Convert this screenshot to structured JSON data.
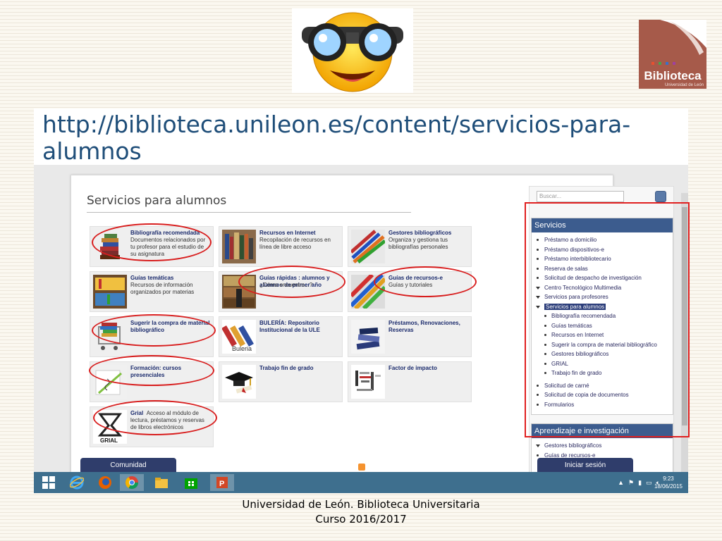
{
  "logo": {
    "name": "Biblioteca",
    "subtitle": "Universidad de León"
  },
  "slide": {
    "title": "http://biblioteca.unileon.es/content/servicios-para-alumnos"
  },
  "page": {
    "heading": "Servicios para alumnos",
    "tiles": [
      {
        "title": "Bibliografía recomendada",
        "desc": "Documentos relacionados por tu profesor para el estudio de su asignatura"
      },
      {
        "title": "Recursos en Internet",
        "desc": "Recopilación de recursos en línea de libre acceso"
      },
      {
        "title": "Gestores bibliográficos",
        "desc": "Organiza y gestiona tus bibliografías personales"
      },
      {
        "title": "Guías temáticas",
        "desc": "Recursos de información organizados por materias"
      },
      {
        "title": "Guías rápidas : alumnos y alumnos de primer año",
        "desc": "¿Cómo encuentro...?"
      },
      {
        "title": "Guías de recursos-e",
        "desc": "Guías y tutoriales"
      },
      {
        "title": "Sugerir la compra de material bibliográfico",
        "desc": ""
      },
      {
        "title": "BULERÍA: Repositorio Institucional de la ULE",
        "desc": ""
      },
      {
        "title": "Préstamos, Renovaciones, Reservas",
        "desc": ""
      },
      {
        "title": "Formación: cursos presenciales",
        "desc": ""
      },
      {
        "title": "Trabajo fin de grado",
        "desc": ""
      },
      {
        "title": "Factor de impacto",
        "desc": ""
      },
      {
        "title": "Grial",
        "desc": "Acceso al módulo de lectura, préstamos y reservas de libros electrónicos"
      }
    ],
    "grial_label": "GRIAL",
    "buleria_label": "Buleria",
    "community_tab": "Comunidad"
  },
  "sidebar": {
    "search_placeholder": "Buscar...",
    "menu_title": "Servicios",
    "items": [
      {
        "label": "Préstamo a domicilio"
      },
      {
        "label": "Préstamo dispositivos-e"
      },
      {
        "label": "Préstamo interbibliotecario"
      },
      {
        "label": "Reserva de salas"
      },
      {
        "label": "Solicitud de despacho de investigación"
      },
      {
        "label": "Centro Tecnológico Multimedia"
      },
      {
        "label": "Servicios para profesores"
      },
      {
        "label": "Servicios para alumnos"
      },
      {
        "label": "Bibliografía recomendada"
      },
      {
        "label": "Guías temáticas"
      },
      {
        "label": "Recursos en Internet"
      },
      {
        "label": "Sugerir la compra de material bibliográfico"
      },
      {
        "label": "Gestores bibliográficos"
      },
      {
        "label": "GRIAL"
      },
      {
        "label": "Trabajo fin de grado"
      },
      {
        "label": "Solicitud de carné"
      },
      {
        "label": "Solicitud de copia de documentos"
      },
      {
        "label": "Formularios"
      }
    ],
    "menu2_title": "Aprendizaje e investigación",
    "menu2_items": [
      {
        "label": "Gestores bibliográficos"
      },
      {
        "label": "Guías de recursos-e"
      }
    ],
    "login_tab": "Iniciar sesión"
  },
  "taskbar": {
    "time": "9:23",
    "date": "18/06/2015",
    "apps": [
      "windows-start",
      "internet-explorer",
      "firefox",
      "chrome",
      "file-explorer",
      "windows-store",
      "powerpoint"
    ]
  },
  "footer": {
    "line1": "Universidad de León. Biblioteca Universitaria",
    "line2": "Curso 2016/2017"
  },
  "colors": {
    "title_blue": "#1f4e79",
    "menu_header": "#3c5c8e",
    "annotation_red": "#e02020",
    "taskbar": "#3e6f8e",
    "logo_bg": "#a65a4a"
  }
}
